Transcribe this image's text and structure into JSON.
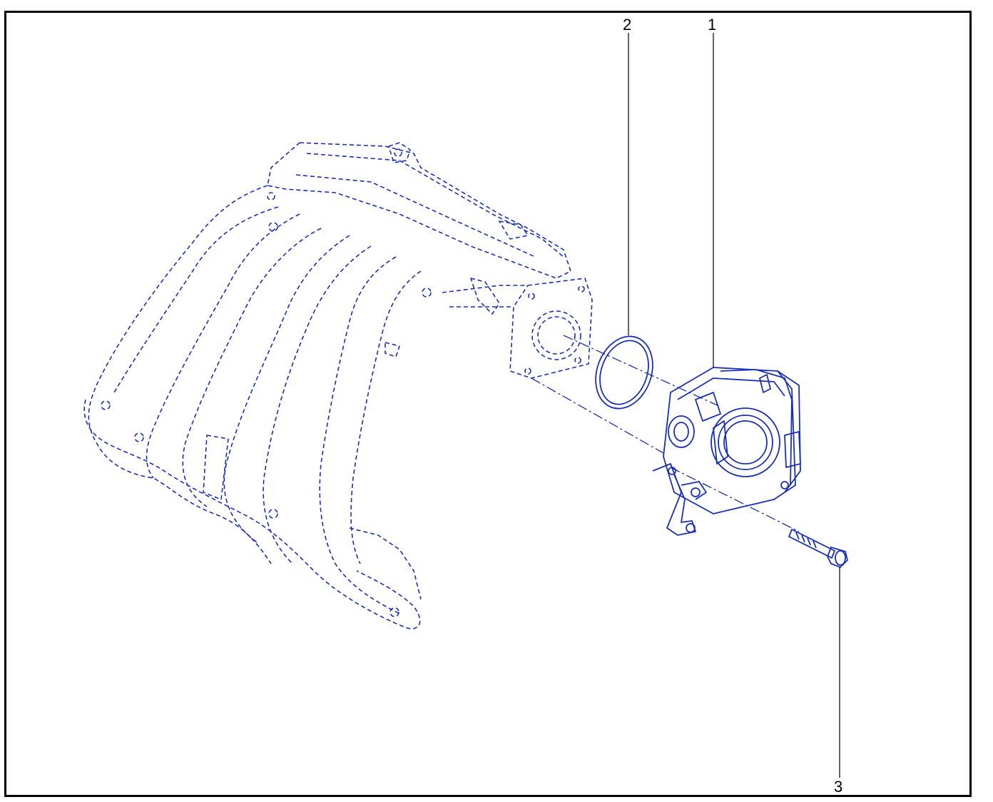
{
  "diagram": {
    "callouts": [
      {
        "id": "1",
        "label": "1"
      },
      {
        "id": "2",
        "label": "2"
      },
      {
        "id": "3",
        "label": "3"
      }
    ],
    "colors": {
      "line": "#1a2fb8",
      "frame": "#000000",
      "leader": "#000000",
      "background": "#ffffff"
    },
    "parts": [
      {
        "name": "intake-manifold",
        "style": "dashed"
      },
      {
        "name": "gasket",
        "style": "solid"
      },
      {
        "name": "throttle-body",
        "style": "solid"
      },
      {
        "name": "bolt",
        "style": "solid"
      }
    ]
  }
}
